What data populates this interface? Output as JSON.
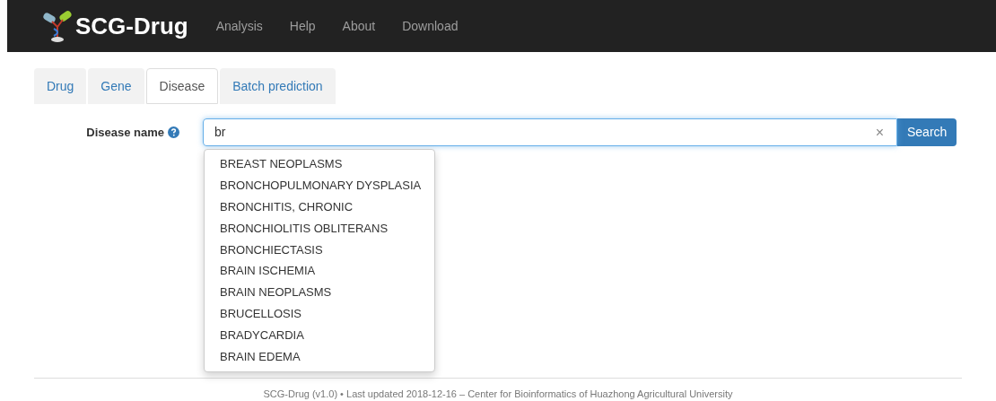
{
  "navbar": {
    "brand": "SCG-Drug",
    "links": [
      "Analysis",
      "Help",
      "About",
      "Download"
    ]
  },
  "tabs": [
    {
      "label": "Drug",
      "selected": false
    },
    {
      "label": "Gene",
      "selected": false
    },
    {
      "label": "Disease",
      "selected": true
    },
    {
      "label": "Batch prediction",
      "selected": false
    }
  ],
  "form": {
    "label": "Disease name",
    "value": "br",
    "clear": "×",
    "button": "Search"
  },
  "suggestions": [
    "BREAST NEOPLASMS",
    "BRONCHOPULMONARY DYSPLASIA",
    "BRONCHITIS, CHRONIC",
    "BRONCHIOLITIS OBLITERANS",
    "BRONCHIECTASIS",
    "BRAIN ISCHEMIA",
    "BRAIN NEOPLASMS",
    "BRUCELLOSIS",
    "BRADYCARDIA",
    "BRAIN EDEMA"
  ],
  "footer": "SCG-Drug (v1.0) • Last updated 2018-12-16 – Center for Bioinformatics of Huazhong Agricultural University"
}
